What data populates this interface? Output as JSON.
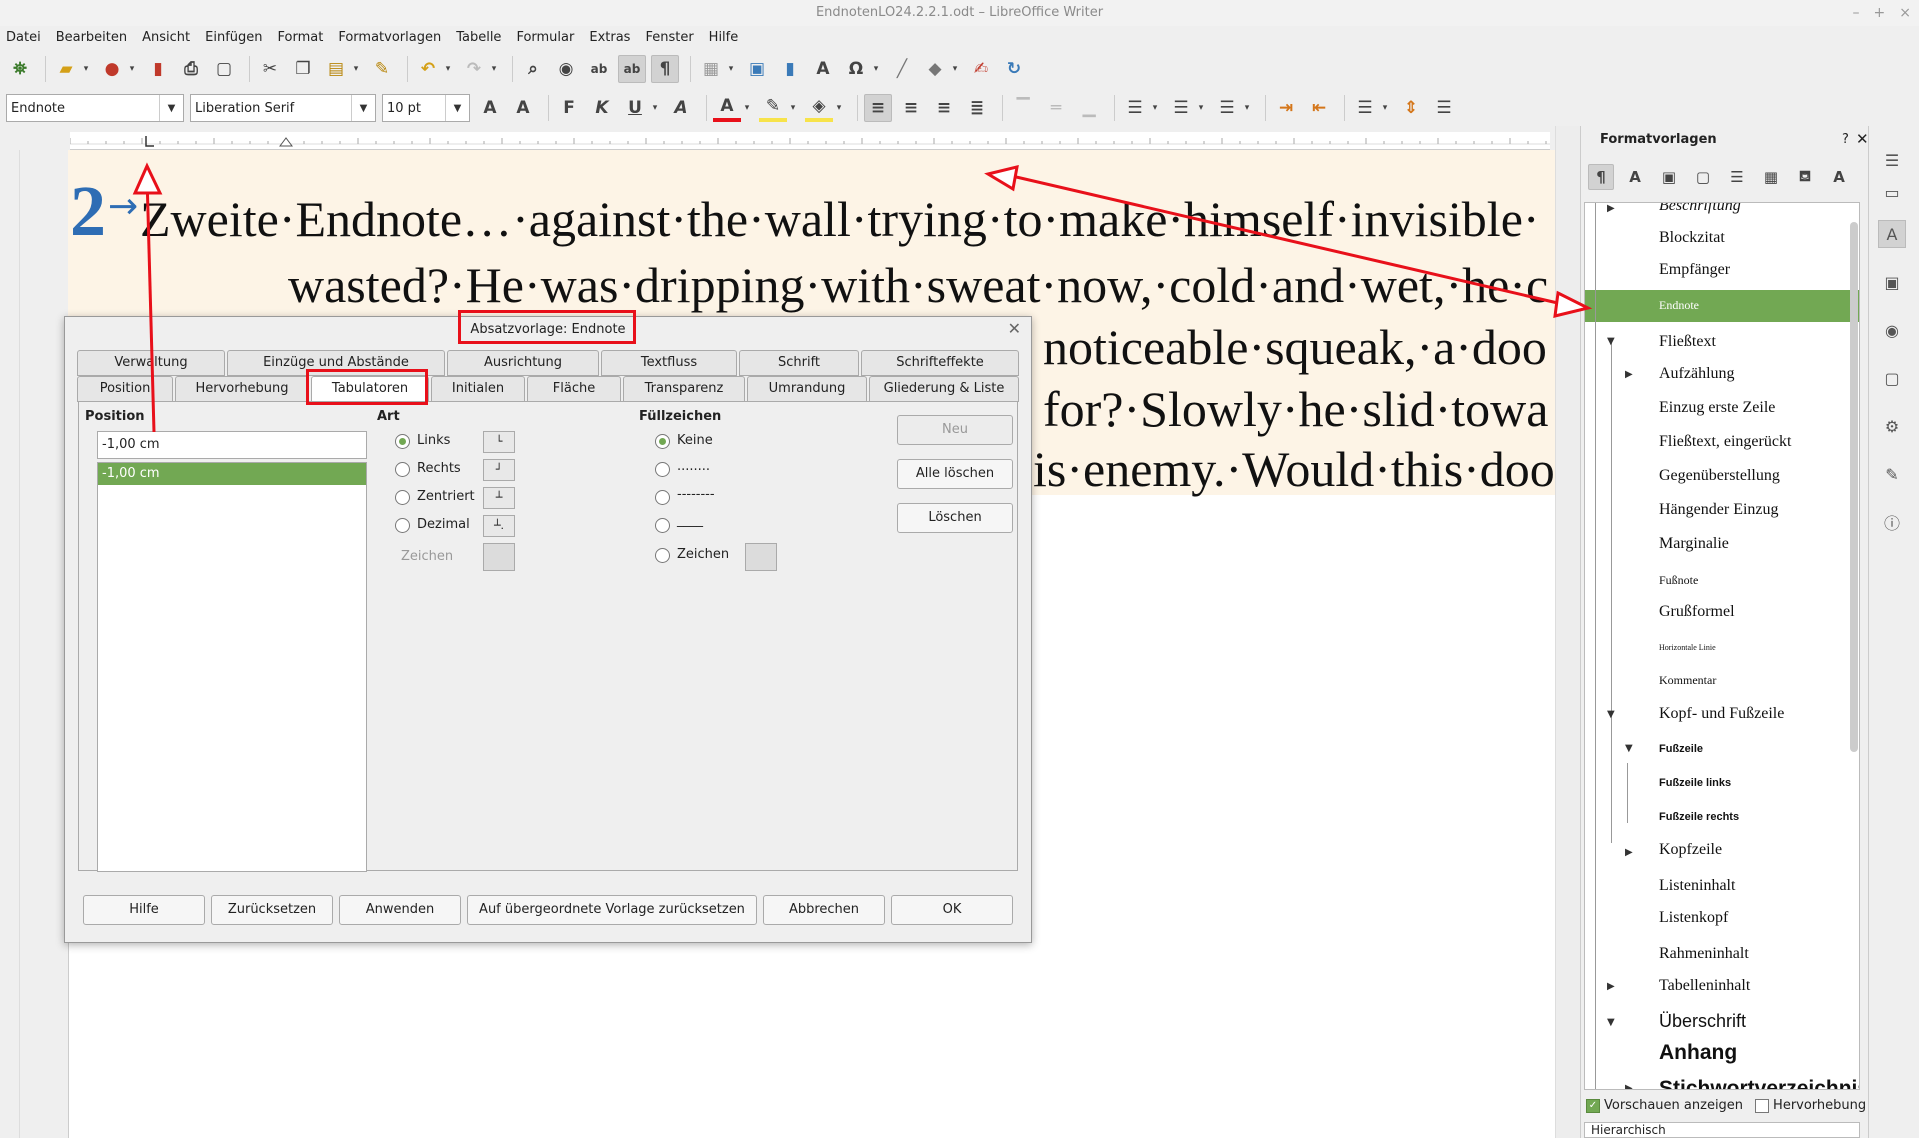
{
  "window": {
    "title": "EndnotenLO24.2.2.1.odt – LibreOffice Writer",
    "controls": [
      "–",
      "+",
      "×"
    ]
  },
  "menu": [
    "Datei",
    "Bearbeiten",
    "Ansicht",
    "Einfügen",
    "Format",
    "Formatvorlagen",
    "Tabelle",
    "Formular",
    "Extras",
    "Fenster",
    "Hilfe"
  ],
  "formatbar": {
    "para_style": "Endnote",
    "font_name": "Liberation Serif",
    "font_size": "10 pt"
  },
  "document": {
    "number": "2",
    "lines": [
      "Zweite·Endnote…·against·the·wall·trying·to·make·himself·invisible·",
      "wasted?·He·was·dripping·with·sweat·now,·cold·and·wet,·he·c",
      "noticeable·squeak,·a·doo",
      "for?·Slowly·he·slid·towa",
      "is·enemy.·Would·this·doo"
    ]
  },
  "sidebar": {
    "title": "Formatvorlagen",
    "help": "?",
    "styles": [
      {
        "label": "Beschriftung"
      },
      {
        "label": "Blockzitat"
      },
      {
        "label": "Empfänger"
      },
      {
        "label": "Endnote",
        "selected": true
      },
      {
        "label": "Fließtext"
      },
      {
        "label": "Aufzählung"
      },
      {
        "label": "Einzug erste Zeile"
      },
      {
        "label": "Fließtext, eingerückt"
      },
      {
        "label": "Gegenüberstellung"
      },
      {
        "label": "Hängender Einzug"
      },
      {
        "label": "Marginalie"
      },
      {
        "label": "Fußnote"
      },
      {
        "label": "Grußformel"
      },
      {
        "label": "Horizontale Linie"
      },
      {
        "label": "Kommentar"
      },
      {
        "label": "Kopf- und Fußzeile"
      },
      {
        "label": "Fußzeile"
      },
      {
        "label": "Fußzeile links"
      },
      {
        "label": "Fußzeile rechts"
      },
      {
        "label": "Kopfzeile"
      },
      {
        "label": "Listeninhalt"
      },
      {
        "label": "Listenkopf"
      },
      {
        "label": "Rahmeninhalt"
      },
      {
        "label": "Tabelleninhalt"
      },
      {
        "label": "Überschrift"
      },
      {
        "label": "Anhang"
      },
      {
        "label": "Stichwortverzeichnis"
      }
    ],
    "preview_label": "Vorschauen anzeigen",
    "highlight_label": "Hervorhebung",
    "filter_value": "Hierarchisch"
  },
  "dialog": {
    "title": "Absatzvorlage: Endnote",
    "tabs_row1": [
      "Verwaltung",
      "Einzüge und Abstände",
      "Ausrichtung",
      "Textfluss",
      "Schrift",
      "Schrifteffekte"
    ],
    "tabs_row2": [
      "Position",
      "Hervorhebung",
      "Tabulatoren",
      "Initialen",
      "Fläche",
      "Transparenz",
      "Umrandung",
      "Gliederung & Liste"
    ],
    "active_tab": "Tabulatoren",
    "position_label": "Position",
    "position_value": "-1,00 cm",
    "position_list": [
      "-1,00 cm"
    ],
    "art_label": "Art",
    "art_options": [
      "Links",
      "Rechts",
      "Zentriert",
      "Dezimal"
    ],
    "art_char_label": "Zeichen",
    "fill_label": "Füllzeichen",
    "fill_options": [
      "Keine",
      "........",
      "--------",
      "____",
      "Zeichen"
    ],
    "side_buttons": [
      "Neu",
      "Alle löschen",
      "Löschen"
    ],
    "bottom_buttons": [
      "Hilfe",
      "Zurücksetzen",
      "Anwenden",
      "Auf übergeordnete Vorlage zurücksetzen",
      "Abbrechen",
      "OK"
    ]
  },
  "colors": {
    "accent": "#72a853",
    "annotation": "#e8101a",
    "number": "#2e6db4",
    "text_bg": "#fdf4e6"
  }
}
